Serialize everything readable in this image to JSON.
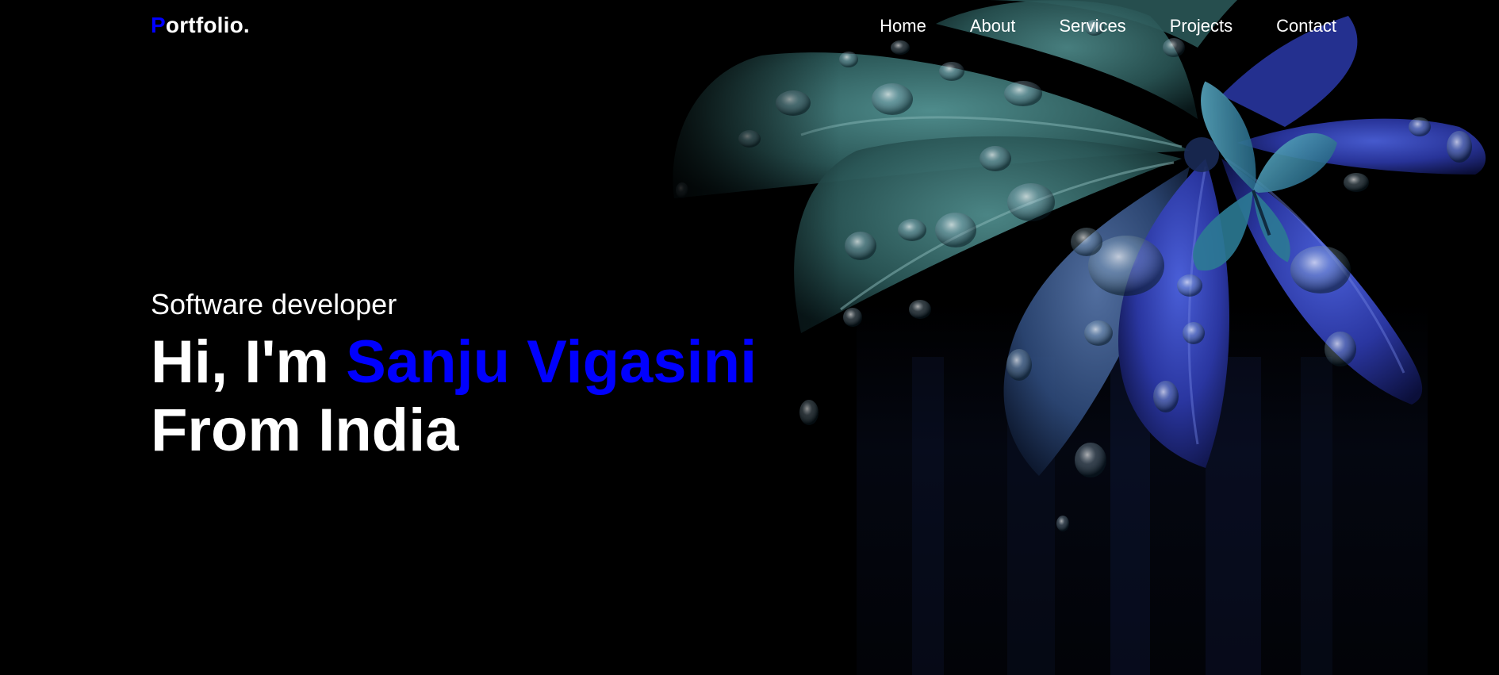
{
  "header": {
    "logo_first_letter": "P",
    "logo_rest": "ortfolio.",
    "nav": [
      {
        "label": "Home"
      },
      {
        "label": "About"
      },
      {
        "label": "Services"
      },
      {
        "label": "Projects"
      },
      {
        "label": "Contact"
      }
    ]
  },
  "hero": {
    "subtitle": "Software developer",
    "greeting": "Hi, I'm ",
    "name": "Sanju Vigasini",
    "location_line": "From India"
  },
  "colors": {
    "background": "#000000",
    "accent": "#0000ff",
    "text": "#ffffff"
  },
  "background_image": "dark leaves with water droplets and a blue butterfly"
}
